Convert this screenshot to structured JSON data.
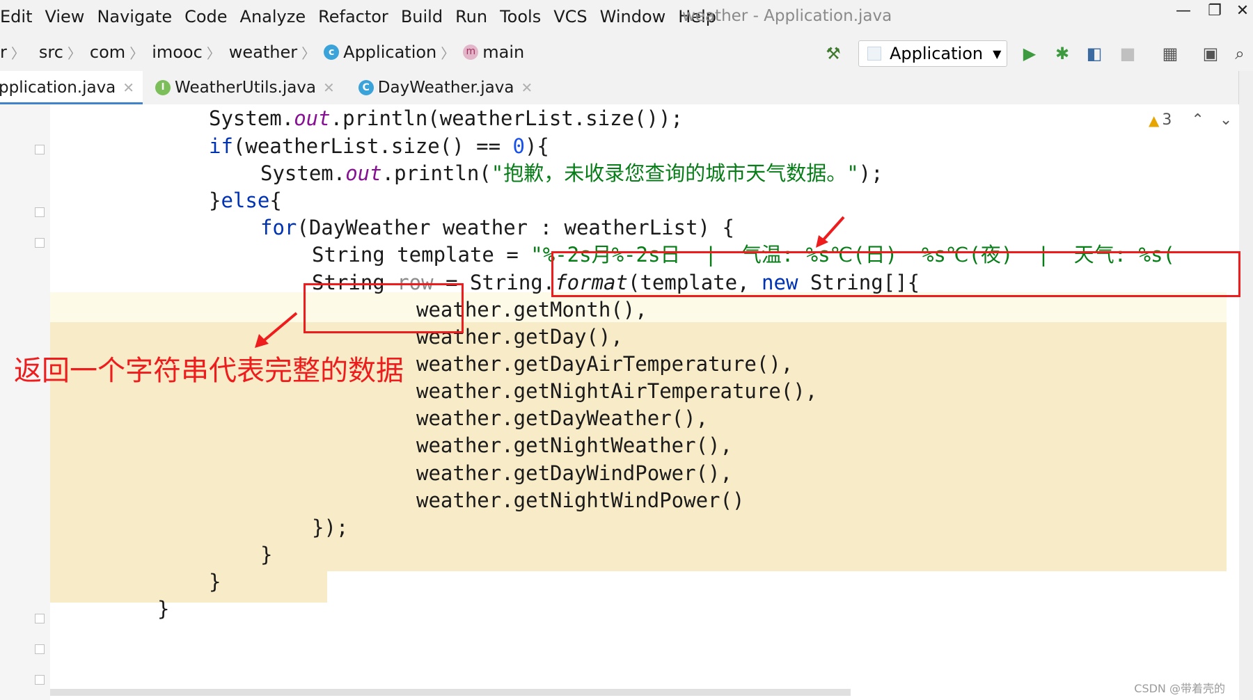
{
  "menu": [
    "Edit",
    "View",
    "Navigate",
    "Code",
    "Analyze",
    "Refactor",
    "Build",
    "Run",
    "Tools",
    "VCS",
    "Window",
    "Help"
  ],
  "window_title": "weather - Application.java",
  "window_controls": {
    "minimize": "—",
    "restore": "❐",
    "close": "✕"
  },
  "breadcrumb": {
    "first": "r",
    "items": [
      "src",
      "com",
      "imooc",
      "weather"
    ],
    "class_name": "Application",
    "method_name": "main"
  },
  "run_config": "Application",
  "tabs": [
    {
      "label": "pplication.java",
      "icon": ""
    },
    {
      "label": "WeatherUtils.java",
      "icon": "I"
    },
    {
      "label": "DayWeather.java",
      "icon": "C"
    }
  ],
  "inspections": {
    "warning_count": "3"
  },
  "code": {
    "l1_a": "System.",
    "l1_b": "out",
    "l1_c": ".println(weatherList.size());",
    "l2_a": "if",
    "l2_b": "(weatherList.size() == ",
    "l2_c": "0",
    "l2_d": "){",
    "l3_a": "System.",
    "l3_b": "out",
    "l3_c": ".println(",
    "l3_d": "\"抱歉，未收录您查询的城市天气数据。\"",
    "l3_e": ");",
    "l4_a": "}",
    "l4_b": "else",
    "l4_c": "{",
    "l5_a": "for",
    "l5_b": "(DayWeather weather : weatherList) {",
    "l6_a": "String template = ",
    "l6_b": "\"%-2s月%-2s日  |  气温: %s℃(日)  %s℃(夜)  |  天气: %s(",
    "l7_a": "String ",
    "l7_b": "row",
    "l7_c": " = String.",
    "l7_d": "format",
    "l7_e": "(template, ",
    "l7_f": "new",
    "l7_g": " String[]{",
    "l8": "weather.getMonth(),",
    "l9": "weather.getDay(),",
    "l10": "weather.getDayAirTemperature(),",
    "l11": "weather.getNightAirTemperature(),",
    "l12": "weather.getDayWeather(),",
    "l13": "weather.getNightWeather(),",
    "l14": "weather.getDayWindPower(),",
    "l15": "weather.getNightWindPower()",
    "l16": "});",
    "l17": "}",
    "l18": "}",
    "l19": "}"
  },
  "annotation_text": "返回一个字符串代表完整的数据",
  "watermark": "CSDN @带着壳的",
  "colors": {
    "annotation": "#ee1c1c",
    "highlight": "#f8ebc7",
    "keyword": "#0033b3",
    "string": "#067d17"
  }
}
